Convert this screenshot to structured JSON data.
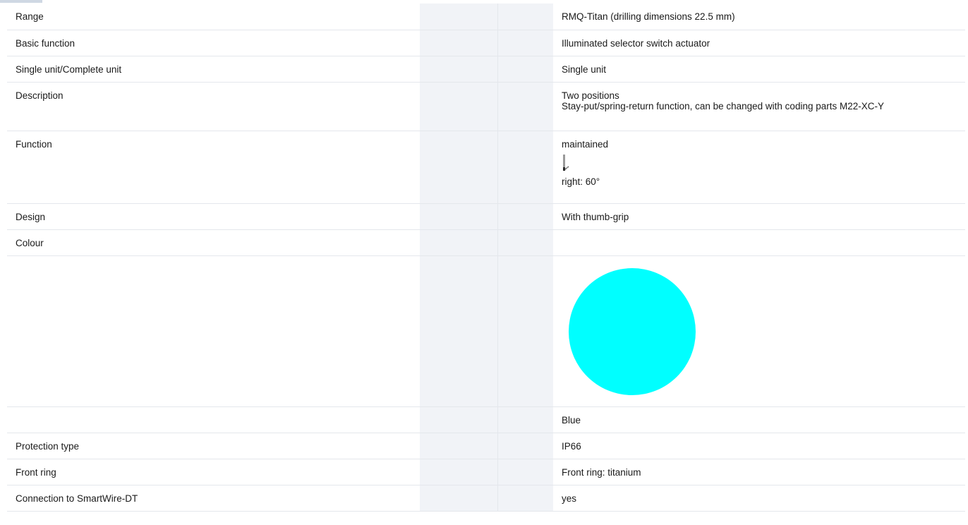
{
  "rows": [
    {
      "label": "Range",
      "value": "RMQ-Titan (drilling dimensions 22.5 mm)"
    },
    {
      "label": "Basic function",
      "value": "Illuminated selector switch actuator"
    },
    {
      "label": "Single unit/Complete unit",
      "value": "Single unit"
    },
    {
      "label": "Description",
      "value_lines": [
        "Two positions",
        "Stay-put/spring-return function, can be changed with coding parts M22-XC-Y"
      ]
    },
    {
      "label": "Function",
      "value": "maintained",
      "icon": "selector-position-icon",
      "value_detail": "right: 60°"
    },
    {
      "label": "Design",
      "value": "With thumb-grip"
    },
    {
      "label": "Colour",
      "value": ""
    },
    {
      "label": "",
      "swatch_color": "#00ffff",
      "icon": "colour-swatch-icon"
    },
    {
      "label": "",
      "value": "Blue"
    },
    {
      "label": "Protection type",
      "value": "IP66"
    },
    {
      "label": "Front ring",
      "value": "Front ring: titanium"
    },
    {
      "label": "Connection to SmartWire-DT",
      "value": "yes"
    }
  ]
}
